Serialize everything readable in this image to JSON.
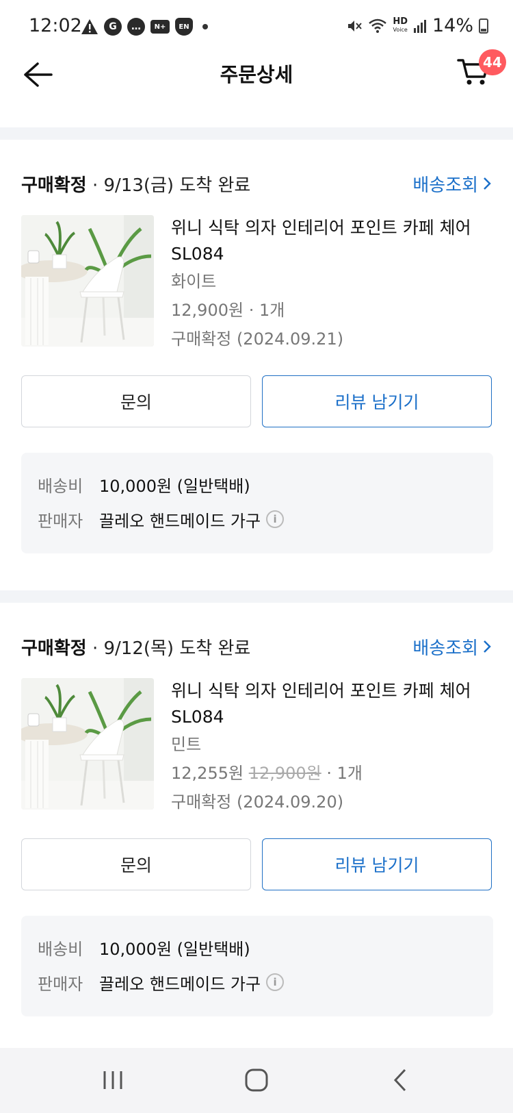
{
  "status_bar": {
    "time": "12:02",
    "notification_icons": [
      "warning-icon",
      "google-icon",
      "chat-icon",
      "news-icon",
      "vpn-shield-icon"
    ],
    "hd_label": "HD",
    "hd_sub": "Voice",
    "battery": "14%"
  },
  "header": {
    "title": "주문상세",
    "cart_badge": "44"
  },
  "orders": [
    {
      "status": "구매확정",
      "date_text": " · 9/13(금) 도착 완료",
      "track_label": "배송조회",
      "product_name": "위니 식탁 의자 인테리어 포인트 카페 체어 SL084",
      "option": "화이트",
      "price": "12,900원",
      "original_price": "",
      "quantity": " · 1개",
      "confirm": "구매확정 (2024.09.21)",
      "inquiry_label": "문의",
      "review_label": "리뷰 남기기",
      "shipping_label": "배송비",
      "shipping_value": "10,000원 (일반택배)",
      "seller_label": "판매자",
      "seller_value": "끌레오 핸드메이드 가구"
    },
    {
      "status": "구매확정",
      "date_text": " · 9/12(목) 도착 완료",
      "track_label": "배송조회",
      "product_name": "위니 식탁 의자 인테리어 포인트 카페 체어 SL084",
      "option": "민트",
      "price": "12,255원",
      "original_price": "12,900원",
      "quantity": " · 1개",
      "confirm": "구매확정 (2024.09.20)",
      "inquiry_label": "문의",
      "review_label": "리뷰 남기기",
      "shipping_label": "배송비",
      "shipping_value": "10,000원 (일반택배)",
      "seller_label": "판매자",
      "seller_value": "끌레오 핸드메이드 가구"
    }
  ],
  "nav": {
    "icons": [
      "recent-apps-icon",
      "home-icon",
      "back-icon"
    ]
  },
  "colors": {
    "accent": "#1a6fc9",
    "badge": "#ff5a5f",
    "section_gap": "#f2f4f7",
    "info_bg": "#f5f6f8"
  }
}
